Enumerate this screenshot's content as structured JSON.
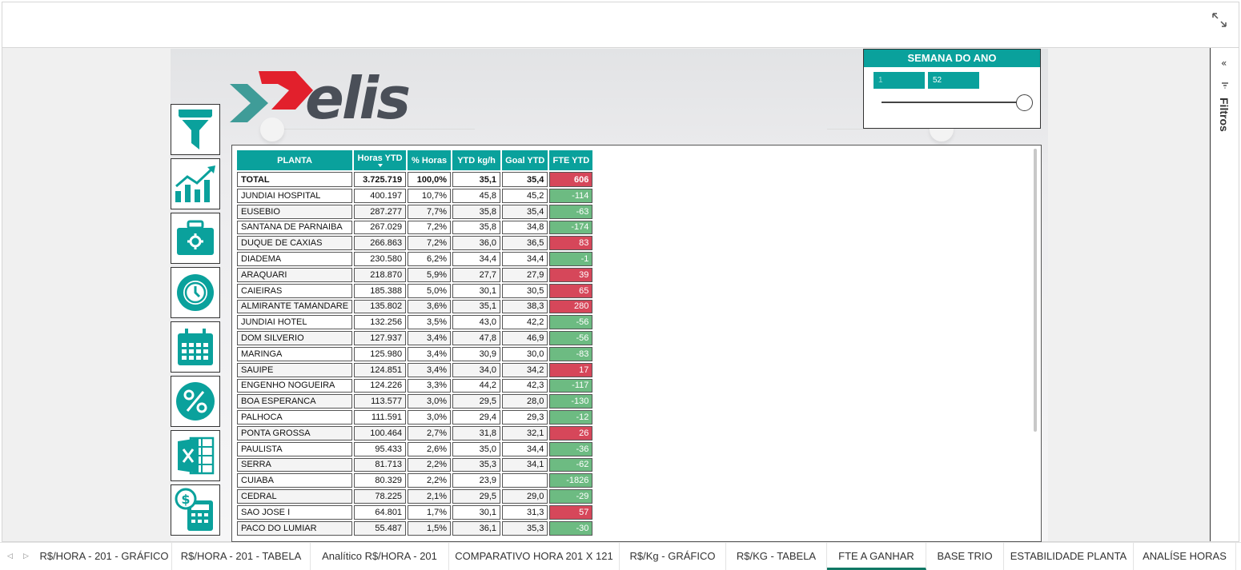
{
  "header": {
    "expand_icon": "expand-icon"
  },
  "slicer": {
    "title": "SEMANA DO ANO",
    "from": "1",
    "to": "52"
  },
  "logo": {
    "text": "elis"
  },
  "nav": [
    "filter-icon",
    "trend-chart-icon",
    "toolbox-icon",
    "timer-icon",
    "calendar-icon",
    "percent-icon",
    "excel-icon",
    "calculator-dollar-icon"
  ],
  "table": {
    "columns": [
      "PLANTA",
      "Horas YTD",
      "% Horas",
      "YTD kg/h",
      "Goal YTD",
      "FTE YTD"
    ],
    "total": {
      "name": "TOTAL",
      "horas": "3.725.719",
      "pct": "100,0%",
      "ytd": "35,1",
      "goal": "35,4",
      "fte": "606",
      "sign": "pos"
    },
    "rows": [
      {
        "name": "JUNDIAI HOSPITAL",
        "horas": "400.197",
        "pct": "10,7%",
        "ytd": "45,8",
        "goal": "45,2",
        "fte": "-114",
        "sign": "neg"
      },
      {
        "name": "EUSEBIO",
        "horas": "287.277",
        "pct": "7,7%",
        "ytd": "35,8",
        "goal": "35,4",
        "fte": "-63",
        "sign": "neg"
      },
      {
        "name": "SANTANA DE PARNAIBA",
        "horas": "267.029",
        "pct": "7,2%",
        "ytd": "35,8",
        "goal": "34,8",
        "fte": "-174",
        "sign": "neg"
      },
      {
        "name": "DUQUE DE CAXIAS",
        "horas": "266.863",
        "pct": "7,2%",
        "ytd": "36,0",
        "goal": "36,5",
        "fte": "83",
        "sign": "pos"
      },
      {
        "name": "DIADEMA",
        "horas": "230.580",
        "pct": "6,2%",
        "ytd": "34,4",
        "goal": "34,4",
        "fte": "-1",
        "sign": "neg"
      },
      {
        "name": "ARAQUARI",
        "horas": "218.870",
        "pct": "5,9%",
        "ytd": "27,7",
        "goal": "27,9",
        "fte": "39",
        "sign": "pos"
      },
      {
        "name": "CAIEIRAS",
        "horas": "185.388",
        "pct": "5,0%",
        "ytd": "30,1",
        "goal": "30,5",
        "fte": "65",
        "sign": "pos"
      },
      {
        "name": "ALMIRANTE TAMANDARE",
        "horas": "135.802",
        "pct": "3,6%",
        "ytd": "35,1",
        "goal": "38,3",
        "fte": "280",
        "sign": "pos"
      },
      {
        "name": "JUNDIAI HOTEL",
        "horas": "132.256",
        "pct": "3,5%",
        "ytd": "43,0",
        "goal": "42,2",
        "fte": "-56",
        "sign": "neg"
      },
      {
        "name": "DOM SILVERIO",
        "horas": "127.937",
        "pct": "3,4%",
        "ytd": "47,8",
        "goal": "46,9",
        "fte": "-56",
        "sign": "neg"
      },
      {
        "name": "MARINGA",
        "horas": "125.980",
        "pct": "3,4%",
        "ytd": "30,9",
        "goal": "30,0",
        "fte": "-83",
        "sign": "neg"
      },
      {
        "name": "SAUIPE",
        "horas": "124.851",
        "pct": "3,4%",
        "ytd": "34,0",
        "goal": "34,2",
        "fte": "17",
        "sign": "pos"
      },
      {
        "name": "ENGENHO NOGUEIRA",
        "horas": "124.226",
        "pct": "3,3%",
        "ytd": "44,2",
        "goal": "42,3",
        "fte": "-117",
        "sign": "neg"
      },
      {
        "name": "BOA ESPERANCA",
        "horas": "113.577",
        "pct": "3,0%",
        "ytd": "29,5",
        "goal": "28,0",
        "fte": "-130",
        "sign": "neg"
      },
      {
        "name": "PALHOCA",
        "horas": "111.591",
        "pct": "3,0%",
        "ytd": "29,4",
        "goal": "29,3",
        "fte": "-12",
        "sign": "neg"
      },
      {
        "name": "PONTA GROSSA",
        "horas": "100.464",
        "pct": "2,7%",
        "ytd": "31,8",
        "goal": "32,1",
        "fte": "26",
        "sign": "pos"
      },
      {
        "name": "PAULISTA",
        "horas": "95.433",
        "pct": "2,6%",
        "ytd": "35,0",
        "goal": "34,4",
        "fte": "-36",
        "sign": "neg"
      },
      {
        "name": "SERRA",
        "horas": "81.713",
        "pct": "2,2%",
        "ytd": "35,3",
        "goal": "34,1",
        "fte": "-62",
        "sign": "neg"
      },
      {
        "name": "CUIABA",
        "horas": "80.329",
        "pct": "2,2%",
        "ytd": "23,9",
        "goal": "",
        "fte": "-1826",
        "sign": "neg"
      },
      {
        "name": "CEDRAL",
        "horas": "78.225",
        "pct": "2,1%",
        "ytd": "29,5",
        "goal": "29,0",
        "fte": "-29",
        "sign": "neg"
      },
      {
        "name": "SAO JOSE I",
        "horas": "64.801",
        "pct": "1,7%",
        "ytd": "30,1",
        "goal": "31,3",
        "fte": "57",
        "sign": "pos"
      },
      {
        "name": "PACO DO LUMIAR",
        "horas": "55.487",
        "pct": "1,5%",
        "ytd": "36,1",
        "goal": "35,3",
        "fte": "-30",
        "sign": "neg"
      }
    ]
  },
  "filters_pane": {
    "label": "Filtros",
    "collapse_icon": "double-chevron-left-icon",
    "filter_icon": "filter-small-icon"
  },
  "tabs": [
    {
      "label": "R$/HORA - 201 - GRÁFICO"
    },
    {
      "label": "R$/HORA - 201 - TABELA"
    },
    {
      "label": "Analítico R$/HORA - 201"
    },
    {
      "label": "COMPARATIVO HORA 201 X 121"
    },
    {
      "label": "R$/Kg - GRÁFICO"
    },
    {
      "label": "R$/KG - TABELA"
    },
    {
      "label": "FTE A GANHAR",
      "active": true
    },
    {
      "label": "BASE TRIO"
    },
    {
      "label": "ESTABILIDADE PLANTA"
    },
    {
      "label": "ANALÍSE HORAS"
    }
  ],
  "colors": {
    "teal": "#0aa19c",
    "red": "#d6475a",
    "green": "#6dbb82",
    "logo_red": "#e2202c",
    "logo_teal": "#3f9c98",
    "tab_active": "#117865"
  }
}
